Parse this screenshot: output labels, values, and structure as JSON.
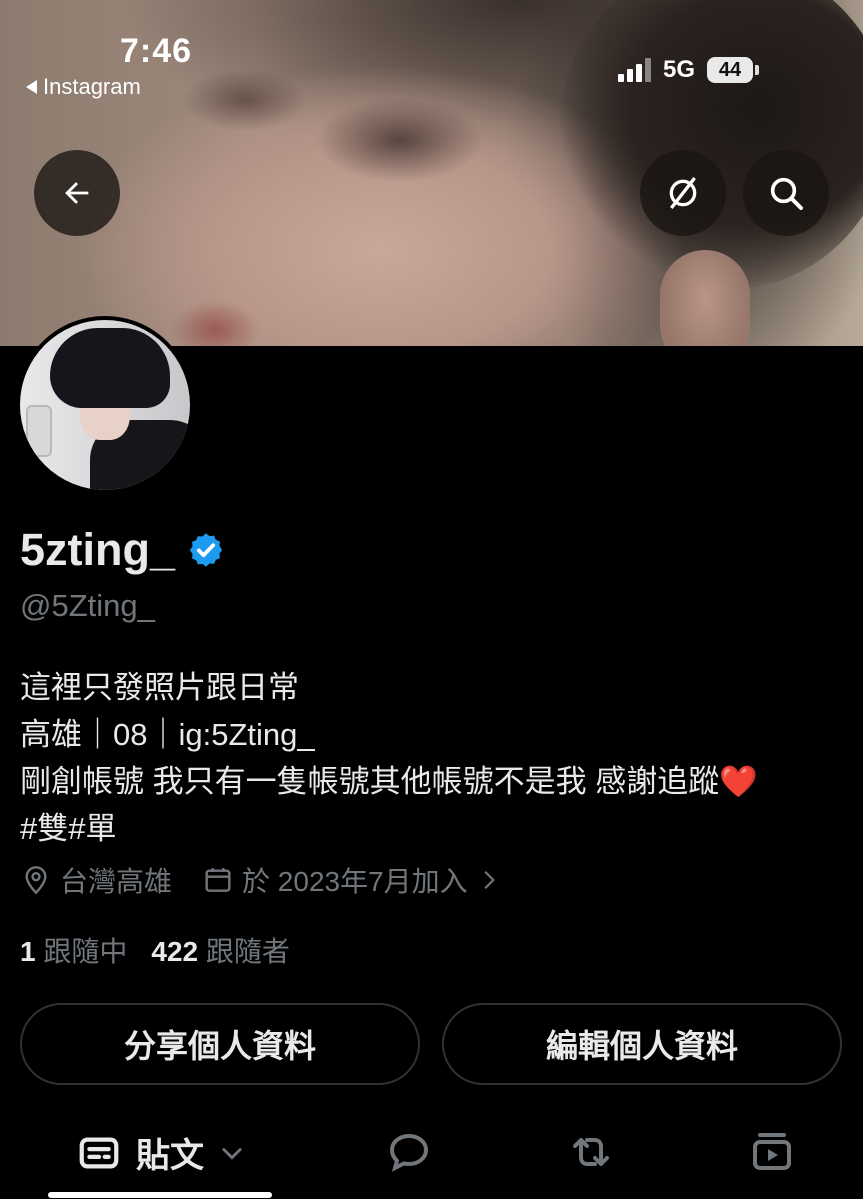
{
  "status_bar": {
    "time": "7:46",
    "back_app": "Instagram",
    "network": "5G",
    "battery": "44"
  },
  "profile": {
    "display_name": "5zting_",
    "handle": "@5Zting_",
    "verified": true,
    "bio_lines": [
      "這裡只發照片跟日常",
      "高雄｜08｜ig:5Zting_",
      "剛創帳號 我只有一隻帳號其他帳號不是我 感謝追蹤❤️",
      "#雙#單"
    ],
    "location": "台灣高雄",
    "joined": "於 2023年7月加入",
    "following_count": "1",
    "following_label": "跟隨中",
    "followers_count": "422",
    "followers_label": "跟隨者"
  },
  "actions": {
    "share_label": "分享個人資料",
    "edit_label": "編輯個人資料"
  },
  "tabs": {
    "posts_label": "貼文"
  },
  "colors": {
    "background": "#000000",
    "text": "#e7e9ea",
    "muted": "#71767b",
    "border": "#2f3336",
    "verified": "#1d9bf0"
  },
  "icons": [
    "back-arrow-icon",
    "hide-icon",
    "search-icon",
    "verified-icon",
    "location-icon",
    "calendar-icon",
    "chevron-right-icon",
    "posts-icon",
    "chevron-down-icon",
    "replies-icon",
    "reposts-icon",
    "media-icon"
  ]
}
